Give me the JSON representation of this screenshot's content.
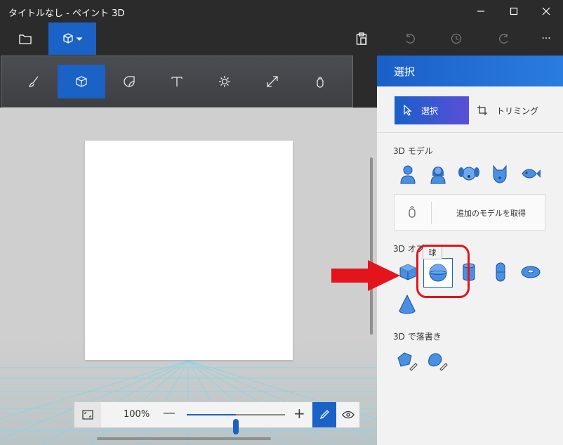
{
  "window": {
    "title": "タイトルなし - ペイント 3D"
  },
  "command_bar": {
    "items": [
      "folder-icon",
      "3d-shapes-icon",
      "paste-icon",
      "undo-icon",
      "history-icon",
      "redo-icon",
      "more-icon"
    ],
    "more_label": "···"
  },
  "flyout": {
    "items": [
      "brush-icon",
      "3d-shapes-icon",
      "sticker-icon",
      "text-icon",
      "effects-icon",
      "canvas-icon",
      "3d-library-icon"
    ],
    "active": "3d-shapes-icon"
  },
  "zoom": {
    "percent_label": "100%",
    "minus": "—",
    "plus": "+",
    "level_fraction": 0.5
  },
  "panel": {
    "title": "選択",
    "tabs": {
      "select": "選択",
      "trim": "トリミング"
    },
    "models_section": "3D モデル",
    "models": [
      "man-icon",
      "woman-icon",
      "dog-icon",
      "cat-icon",
      "fish-icon"
    ],
    "get_more": "追加のモデルを取得",
    "objects_section": "3D オブジ",
    "tooltip": "球",
    "objects": [
      "cube-icon",
      "sphere-icon",
      "cylinder-icon",
      "capsule-icon",
      "donut-icon",
      "cone-icon"
    ],
    "selected_object": "sphere-icon",
    "doodle_section": "3D で落書き",
    "doodles": [
      "sharp-doodle-icon",
      "soft-doodle-icon"
    ]
  },
  "colors": {
    "accent": "#1a62c6",
    "annotation": "#e3141c",
    "titlebar": "#2b2b2b",
    "panel": "#f2f2f2"
  }
}
